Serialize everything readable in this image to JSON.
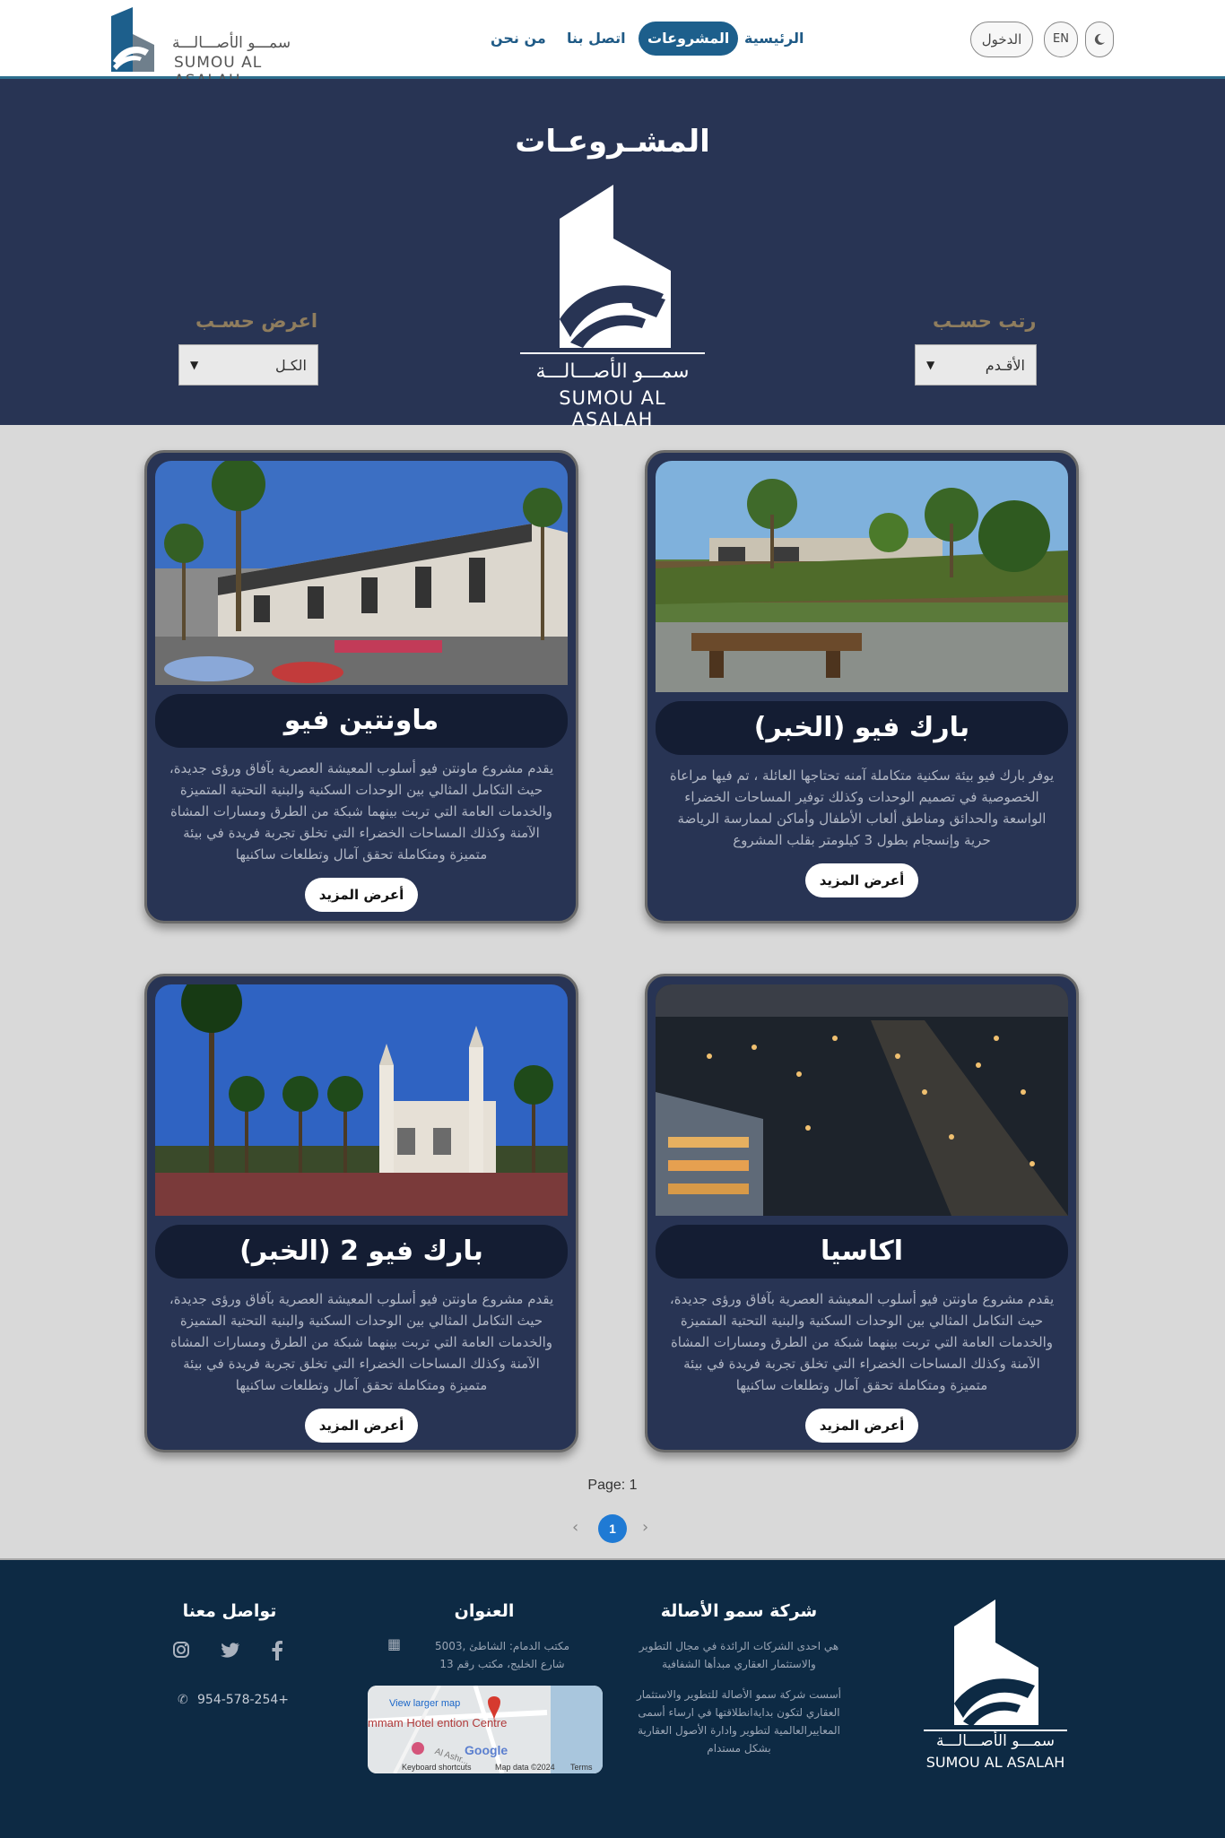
{
  "header": {
    "logo_ar": "سمـــو الأصـــالـــة",
    "logo_en": "SUMOU AL ASALAH",
    "nav": [
      {
        "label": "الرئيسية"
      },
      {
        "label": "المشروعات"
      },
      {
        "label": "اتصل بنا"
      },
      {
        "label": "من نحن"
      }
    ],
    "login_label": "الدخول",
    "lang_label": "EN",
    "theme_icon": "moon-icon"
  },
  "hero": {
    "title": "المشـروعـات",
    "logo_ar": "سمـــو الأصـــالـــة",
    "logo_en": "SUMOU AL ASALAH",
    "sort_label": "رتب حسـب",
    "sort_value": "الأقـدم",
    "filter_label": "اعرض حسـب",
    "filter_value": "الكـل"
  },
  "projects": [
    {
      "name": "بارك فيو (الخبر)",
      "desc": "يوفر بارك فيو بيئة سكنية متكاملة آمنه تحتاجها العائلة ، تم فيها مراعاة الخصوصية في تصميم الوحدات وكذلك توفير المساحات الخضراء الواسعة والحدائق ومناطق ألعاب الأطفال وأماكن لممارسة الرياضة حرية وإنسجام بطول 3 كيلومتر بقلب المشروع",
      "button": "أعرض المزيد"
    },
    {
      "name": "ماونتين فيو",
      "desc": "يقدم مشروع ماونتن فيو أسلوب المعيشة العصرية بآفاق ورؤى جديدة، حيث التكامل المثالي بين الوحدات السكنية والبنية التحتية المتميزة والخدمات العامة التي تربت بينهما شبكة من الطرق ومسارات المشاة الآمنة وكذلك المساحات الخضراء التي تخلق تجربة فريدة في بيئة متميزة ومتكاملة تحقق آمال وتطلعات ساكنيها",
      "button": "أعرض المزيد"
    },
    {
      "name": "اكاسيا",
      "desc": "يقدم مشروع ماونتن فيو أسلوب المعيشة العصرية بآفاق ورؤى جديدة، حيث التكامل المثالي بين الوحدات السكنية والبنية التحتية المتميزة والخدمات العامة التي تربت بينهما شبكة من الطرق ومسارات المشاة الآمنة وكذلك المساحات الخضراء التي تخلق تجربة فريدة في بيئة متميزة ومتكاملة تحقق آمال وتطلعات ساكنيها",
      "button": "أعرض المزيد"
    },
    {
      "name": "بارك فيو 2 (الخبر)",
      "desc": "يقدم مشروع ماونتن فيو أسلوب المعيشة العصرية بآفاق ورؤى جديدة، حيث التكامل المثالي بين الوحدات السكنية والبنية التحتية المتميزة والخدمات العامة التي تربت بينهما شبكة من الطرق ومسارات المشاة الآمنة وكذلك المساحات الخضراء التي تخلق تجربة فريدة في بيئة متميزة ومتكاملة تحقق آمال وتطلعات ساكنيها",
      "button": "أعرض المزيد"
    }
  ],
  "pagination": {
    "label": "Page: 1",
    "current": "1",
    "prev_icon": "chevron-left-icon",
    "next_icon": "chevron-right-icon"
  },
  "footer": {
    "logo_ar": "سمـــو الأصـــالـــة",
    "logo_en": "SUMOU AL ASALAH",
    "company_title": "شركة سمو الأصالة",
    "company_text_1": "هي احدى الشركات الرائدة في مجال التطوير والاستثمار العقاري مبدأها الشفافية",
    "company_text_2": "أسست شركة سمو الأصالة للتطوير والاستثمار العقاري لتكون بدايةانطلاقتها في ارساء أسمى المعاييرالعالمية لتطوير وادارة الأصول العقارية بشكل مستدام",
    "address_title": "العنوان",
    "address_text": "مكتب الدمام: الشاطئ ,5003 شارع الخليج، مكتب رقم 13",
    "map_link": "View larger map",
    "map_place": "mmam Hotel ention Centre",
    "map_street": "Al Ashr...",
    "map_brand": "Google",
    "map_shortcuts": "Keyboard shortcuts",
    "map_data": "Map data ©2024",
    "map_terms": "Terms",
    "contact_title": "تواصل معنا",
    "phone": "954-578-254+",
    "socials": [
      "instagram-icon",
      "twitter-icon",
      "facebook-icon"
    ]
  },
  "colors": {
    "hero_bg": "#283454",
    "footer_bg": "#0d2a44",
    "accent": "#1d5f8c",
    "pager_active": "#1f7ad4"
  }
}
